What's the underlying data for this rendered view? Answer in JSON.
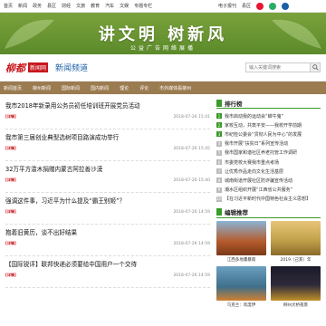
{
  "topbar": {
    "nav": [
      "首页",
      "新闻",
      "政务",
      "县区",
      "财经",
      "文旅",
      "教育",
      "汽车",
      "文娱",
      "专题专栏"
    ],
    "right": [
      "电子报刊",
      "县区"
    ],
    "colors": {
      "weibo": "#e6162d",
      "wechat": "#2aae67",
      "mobile": "#1a5fa8"
    }
  },
  "banner": {
    "main": "讲文明 树新风",
    "sub": "公益广告网络展播",
    "colors": {
      "bg": "#6a9632"
    }
  },
  "header": {
    "logo_mark": "柳都",
    "logo_box": "新闻网",
    "channel": "新闻频道",
    "search_placeholder": "输入关键词搜索"
  },
  "menu": {
    "items": [
      "新闻首页",
      "柳州新闻",
      "国际新闻",
      "国内新闻",
      "理论",
      "评论",
      "市外媒体看柳州"
    ],
    "color": "#9b7b50"
  },
  "articles": [
    {
      "title": "我市2018年新录用公务员初任培训班开展党员活动",
      "date": "2018-07-26 15:41",
      "cat": "[详情]"
    },
    {
      "title": "我市第三届创业典型选树项目路演成功举行",
      "date": "2018-07-26 15:45",
      "cat": "[详情]"
    },
    {
      "title": "32万平方滥木捐赠内蒙古阿拉善沙漠",
      "date": "2018-07-26 15:40",
      "cat": "[详情]"
    },
    {
      "title": "强调这件事，习近平为什么提及“霸王别姬”？",
      "date": "2018-07-26 14:59",
      "cat": "[详情]"
    },
    {
      "title": "抱着旧黄历，谈不出好结果",
      "date": "2018-07-26 14:59",
      "cat": "[详情]"
    },
    {
      "title": "【国际锐评】联邦快递必须要给中国用户一个交待",
      "date": "2018-07-26 14:59",
      "cat": "[详情]"
    }
  ],
  "rank": {
    "title": "排行榜",
    "items": [
      "我市启动我的运动会“蝉牛鬼”",
      "家校互动，共筑平安——我校开学前期",
      "市纪检公委会“贯彻人民为中心”的发展",
      "我市开展“扶贫日”系列宣传活动",
      "我市国家和谐社区养老托管工作调研",
      "市委党校大赛我市重点考场",
      "让优秀作品走向文化生活基层",
      "城南街道开展社区防诈骗宣传活动",
      "潮水区组织开展“江西省公共服务”",
      "【在习近平新时代中国特色社会主义思想】"
    ]
  },
  "picks": {
    "title": "编辑推荐",
    "items": [
      {
        "caption": "江西多地遭暴雨",
        "color": "#b55a2a"
      },
      {
        "caption": "2019（己亥）年",
        "color": "#c2a24a"
      },
      {
        "caption": "乌克兰：欢度伊",
        "color": "#3f6f8a"
      },
      {
        "caption": "柳州大桥夜景",
        "color": "#2f2a3a"
      }
    ]
  }
}
